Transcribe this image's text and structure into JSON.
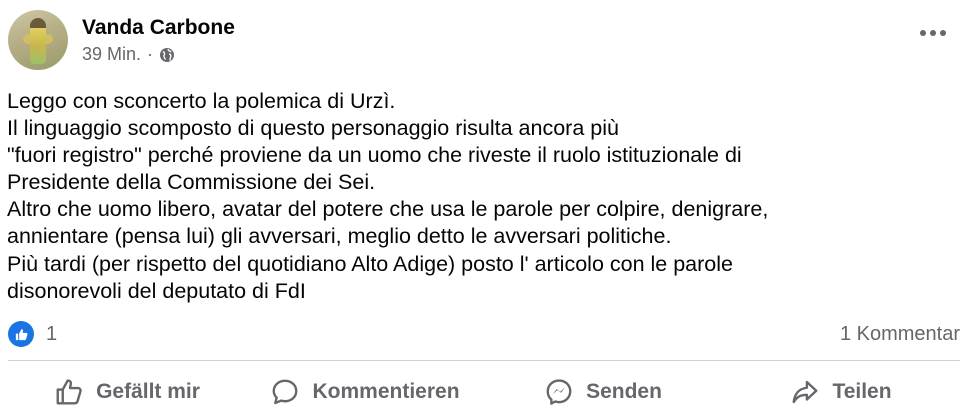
{
  "post": {
    "author": "Vanda Carbone",
    "time": "39 Min.",
    "separator": "·",
    "paragraphs": [
      "Leggo con sconcerto la polemica di Urzì.",
      "Il linguaggio scomposto di questo personaggio risulta ancora più",
      "\"fuori registro\" perché proviene da un uomo che riveste il ruolo istituzionale di",
      "Presidente della Commissione dei Sei.",
      "Altro che uomo libero, avatar del potere che usa le parole per colpire, denigrare,",
      "annientare (pensa lui) gli avversari, meglio detto le avversari politiche.",
      "Più tardi (per rispetto del quotidiano Alto Adige) posto l' articolo con le parole",
      "disonorevoli del deputato di FdI"
    ]
  },
  "stats": {
    "reaction_count": "1",
    "comments": "1 Kommentar"
  },
  "actions": {
    "like": "Gefällt mir",
    "comment": "Kommentieren",
    "send": "Senden",
    "share": "Teilen"
  },
  "icons": {
    "privacy": "globe-icon",
    "menu": "more-options-icon",
    "like": "thumbs-up-icon",
    "comment": "speech-bubble-icon",
    "send": "messenger-icon",
    "share": "share-arrow-icon"
  },
  "colors": {
    "like_badge": "#1b74e4",
    "secondary_text": "#65676b"
  }
}
